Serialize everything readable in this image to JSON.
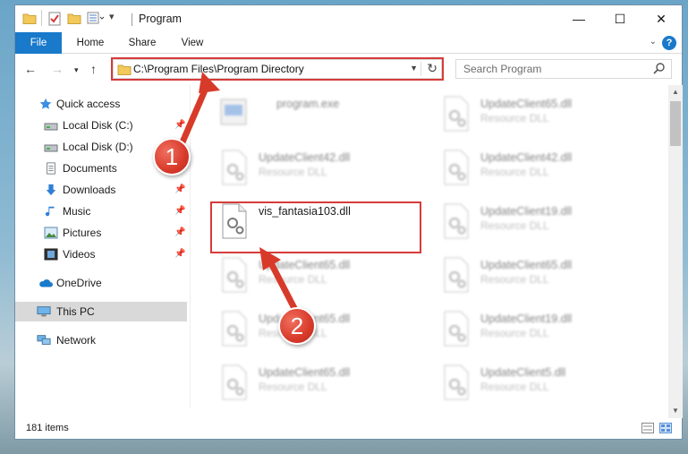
{
  "window": {
    "title": "Program",
    "controls": {
      "minimize": "—",
      "maximize": "☐",
      "close": "✕"
    }
  },
  "ribbon": {
    "tabs": [
      "File",
      "Home",
      "Share",
      "View"
    ],
    "help": "?"
  },
  "address": {
    "path": "C:\\Program Files\\Program Directory",
    "search_placeholder": "Search Program"
  },
  "sidebar": {
    "items": [
      {
        "label": "Quick access",
        "icon": "star-icon",
        "pinned": false
      },
      {
        "label": "Local Disk (C:)",
        "icon": "drive-icon",
        "pinned": true
      },
      {
        "label": "Local Disk (D:)",
        "icon": "drive-icon",
        "pinned": false
      },
      {
        "label": "Documents",
        "icon": "documents-icon",
        "pinned": true
      },
      {
        "label": "Downloads",
        "icon": "download-icon",
        "pinned": true
      },
      {
        "label": "Music",
        "icon": "music-icon",
        "pinned": true
      },
      {
        "label": "Pictures",
        "icon": "pictures-icon",
        "pinned": true
      },
      {
        "label": "Videos",
        "icon": "videos-icon",
        "pinned": true
      },
      {
        "label": "OneDrive",
        "icon": "cloud-icon",
        "pinned": false
      },
      {
        "label": "This PC",
        "icon": "computer-icon",
        "pinned": false,
        "selected": true
      },
      {
        "label": "Network",
        "icon": "network-icon",
        "pinned": false
      }
    ]
  },
  "files": [
    {
      "name": "program.exe",
      "type": ""
    },
    {
      "name": "UpdateClient65.dll",
      "type": "Resource DLL"
    },
    {
      "name": "UpdateClient42.dll",
      "type": "Resource DLL"
    },
    {
      "name": "UpdateClient42.dll",
      "type": "Resource DLL"
    },
    {
      "name": "vis_fantasia103.dll",
      "type": ""
    },
    {
      "name": "UpdateClient19.dll",
      "type": "Resource DLL"
    },
    {
      "name": "UpdateClient65.dll",
      "type": "Resource DLL"
    },
    {
      "name": "UpdateClient65.dll",
      "type": "Resource DLL"
    },
    {
      "name": "UpdateClient65.dll",
      "type": "Resource DLL"
    },
    {
      "name": "UpdateClient19.dll",
      "type": "Resource DLL"
    },
    {
      "name": "UpdateClient65.dll",
      "type": "Resource DLL"
    },
    {
      "name": "UpdateClient5.dll",
      "type": "Resource DLL"
    }
  ],
  "status": {
    "item_count": "181 items"
  },
  "callouts": [
    "1",
    "2"
  ],
  "colors": {
    "accent": "#1979ca",
    "highlight": "#d63b3b",
    "selected": "#d9d9d9"
  }
}
